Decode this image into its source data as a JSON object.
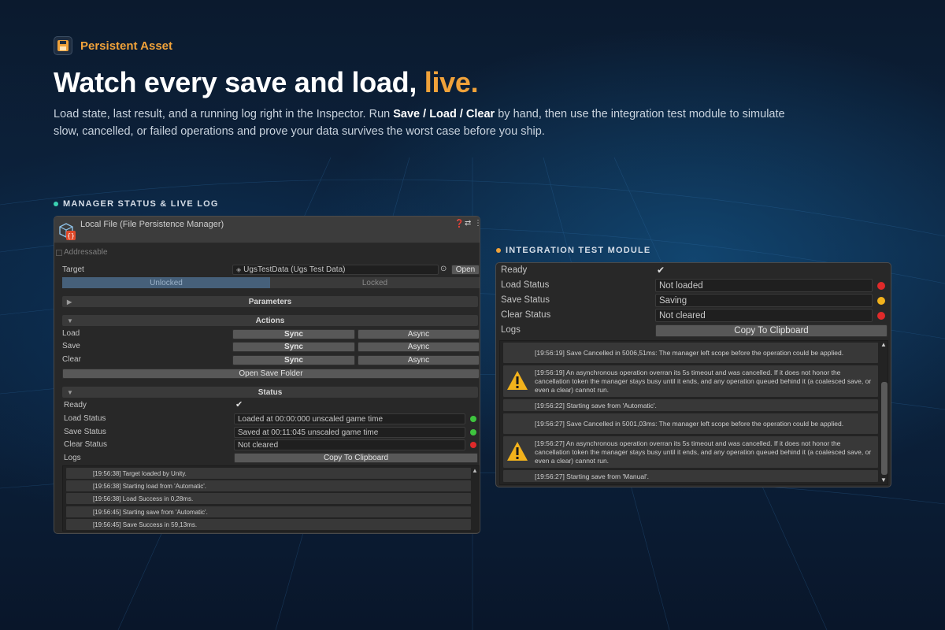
{
  "brand": {
    "name": "Persistent Asset",
    "icon": "floppy-disk-icon"
  },
  "headline": {
    "main": "Watch every save and load,",
    "accent": "live."
  },
  "lede": {
    "part1": "Load state, last result, and a running log right in the Inspector. Run ",
    "bold": "Save / Load / Clear",
    "part2": " by hand, then use the integration test module to simulate slow, cancelled, or failed operations and prove your data survives the worst case before you ship."
  },
  "colors": {
    "accent": "#f0a23a",
    "teal_dot": "#3bd1b2",
    "green": "#3ec43e",
    "red": "#e02a2a",
    "amber": "#f2b21c"
  },
  "left_section": {
    "label": "MANAGER STATUS & LIVE LOG"
  },
  "right_section": {
    "label": "INTEGRATION TEST MODULE"
  },
  "manager": {
    "title": "Local File (File Persistence Manager)",
    "addressable": "Addressable",
    "target_label": "Target",
    "target_value": "UgsTestData (Ugs Test Data)",
    "open_button": "Open",
    "tabs": [
      "Unlocked",
      "Locked"
    ],
    "parameters": "Parameters",
    "actions": "Actions",
    "action_rows": [
      {
        "label": "Load",
        "sync": "Sync",
        "async": "Async"
      },
      {
        "label": "Save",
        "sync": "Sync",
        "async": "Async"
      },
      {
        "label": "Clear",
        "sync": "Sync",
        "async": "Async"
      }
    ],
    "open_save_folder": "Open Save Folder",
    "status": "Status",
    "ready_label": "Ready",
    "status_rows": [
      {
        "label": "Load Status",
        "value": "Loaded at 00:00:000 unscaled game time",
        "state": "green"
      },
      {
        "label": "Save Status",
        "value": "Saved at 00:11:045 unscaled game time",
        "state": "green"
      },
      {
        "label": "Clear Status",
        "value": "Not cleared",
        "state": "red"
      }
    ],
    "logs_label": "Logs",
    "copy_button": "Copy To Clipboard",
    "logs": [
      "[19:56:38] Target loaded by Unity.",
      "[19:56:38] Starting load from 'Automatic'.",
      "[19:56:38] Load Success in 0,28ms.",
      "[19:56:45] Starting save from 'Automatic'.",
      "[19:56:45] Save Success in 59,13ms."
    ]
  },
  "test_module": {
    "ready_label": "Ready",
    "status_rows": [
      {
        "label": "Load Status",
        "value": "Not loaded",
        "state": "red"
      },
      {
        "label": "Save Status",
        "value": "Saving",
        "state": "amber"
      },
      {
        "label": "Clear Status",
        "value": "Not cleared",
        "state": "red"
      }
    ],
    "logs_label": "Logs",
    "copy_button": "Copy To Clipboard",
    "logs": [
      {
        "text": "[19:56:19] Save Cancelled in 5006,51ms: The manager left scope before the operation could be applied.",
        "warn": false
      },
      {
        "text": "[19:56:19] An asynchronous operation overran its 5s timeout and was cancelled. If it does not honor the cancellation token the manager stays busy until it ends, and any operation queued behind it (a coalesced save, or even a clear) cannot run.",
        "warn": true
      },
      {
        "text": "[19:56:22] Starting save from 'Automatic'.",
        "warn": false
      },
      {
        "text": "[19:56:27] Save Cancelled in 5001,03ms: The manager left scope before the operation could be applied.",
        "warn": false
      },
      {
        "text": "[19:56:27] An asynchronous operation overran its 5s timeout and was cancelled. If it does not honor the cancellation token the manager stays busy until it ends, and any operation queued behind it (a coalesced save, or even a clear) cannot run.",
        "warn": true
      },
      {
        "text": "[19:56:27] Starting save from 'Manual'.",
        "warn": false
      }
    ]
  }
}
